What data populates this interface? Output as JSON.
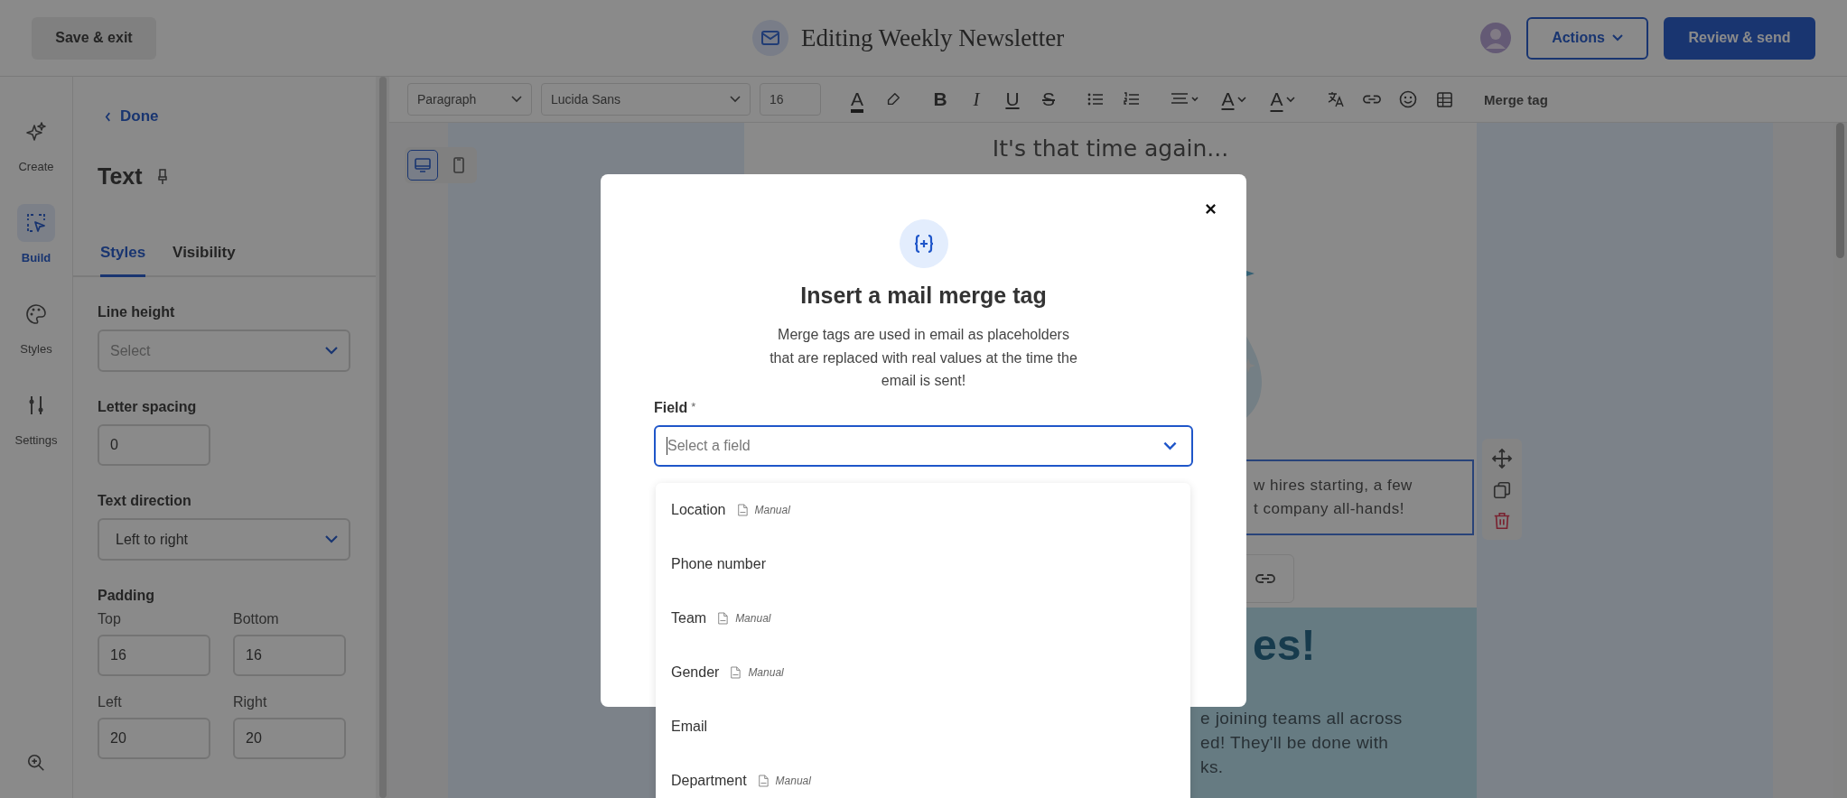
{
  "top_bar": {
    "save_button": "Save & exit",
    "title": "Editing Weekly Newsletter",
    "actions_button": "Actions",
    "review_button": "Review & send"
  },
  "rail": [
    {
      "kind": "sparkle",
      "label": "Create",
      "selected": false
    },
    {
      "kind": "cursor",
      "label": "Build",
      "selected": true
    },
    {
      "kind": "palette",
      "label": "Styles",
      "selected": false
    },
    {
      "kind": "sliders",
      "label": "Settings",
      "selected": false
    }
  ],
  "panel": {
    "back_link": "Done",
    "heading": "Text",
    "tabs": [
      {
        "label": "Styles",
        "selected": true
      },
      {
        "label": "Visibility",
        "selected": false
      }
    ],
    "line_height": {
      "label": "Line height",
      "placeholder": "Select"
    },
    "letter_spacing": {
      "label": "Letter spacing",
      "value": "0"
    },
    "text_direction": {
      "label": "Text direction",
      "value": "Left to right"
    },
    "padding": {
      "label": "Padding",
      "fields": [
        {
          "label": "Top",
          "value": "16"
        },
        {
          "label": "Bottom",
          "value": "16"
        },
        {
          "label": "Left",
          "value": "20"
        },
        {
          "label": "Right",
          "value": "20"
        }
      ]
    }
  },
  "toolbar": {
    "block_style": "Paragraph",
    "font": "Lucida Sans",
    "font_size": "16",
    "buttons": [
      {
        "kind": "color",
        "label": "A"
      },
      {
        "kind": "highlight"
      },
      {
        "kind": "bold",
        "label": "B"
      },
      {
        "kind": "italic",
        "label": "I"
      },
      {
        "kind": "underline",
        "label": "U"
      },
      {
        "kind": "strike",
        "label": "S"
      },
      {
        "kind": "bullets"
      },
      {
        "kind": "numbers"
      },
      {
        "kind": "align"
      },
      {
        "kind": "text-style",
        "label": "A"
      },
      {
        "kind": "text-direction",
        "label": "A"
      },
      {
        "kind": "translate"
      },
      {
        "kind": "link"
      },
      {
        "kind": "emoji"
      },
      {
        "kind": "table"
      }
    ],
    "merge_tag": "Merge tag"
  },
  "device_toggle": [
    {
      "kind": "desktop",
      "selected": true
    },
    {
      "kind": "mobile",
      "selected": false
    }
  ],
  "email": {
    "intro": "It's that time again...",
    "selected_text": [
      "w hires starting, a few",
      "t company all-hands!"
    ],
    "section_heading": "es!",
    "section_body": [
      "e joining teams all across",
      "ed! They'll be done with",
      "ks."
    ]
  },
  "modal": {
    "title": "Insert a mail merge tag",
    "description": [
      "Merge tags are used in email as placeholders",
      "that are replaced with real values at the time the",
      "email is sent!"
    ],
    "field": {
      "label": "Field",
      "required_mark": "*",
      "placeholder": "Select a field"
    },
    "options": [
      {
        "label": "Location",
        "source": "Manual"
      },
      {
        "label": "Phone number"
      },
      {
        "label": "Team",
        "source": "Manual"
      },
      {
        "label": "Gender",
        "source": "Manual"
      },
      {
        "label": "Email"
      },
      {
        "label": "Department",
        "source": "Manual"
      }
    ]
  }
}
